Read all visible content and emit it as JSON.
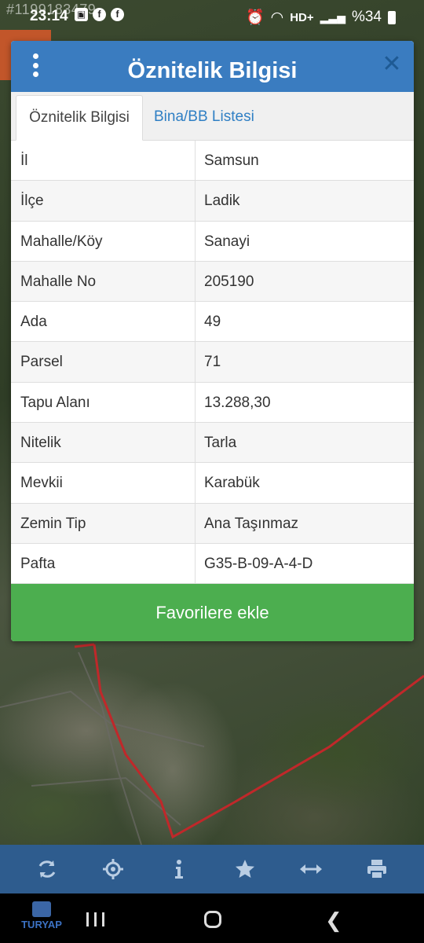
{
  "watermark": "#1199183479",
  "status_bar": {
    "time": "23:14",
    "network": "HD+",
    "battery": "%34"
  },
  "dialog": {
    "title": "Öznitelik Bilgisi",
    "tabs": [
      {
        "label": "Öznitelik Bilgisi",
        "active": true
      },
      {
        "label": "Bina/BB Listesi",
        "active": false
      }
    ],
    "attributes": [
      {
        "key": "İl",
        "value": "Samsun"
      },
      {
        "key": "İlçe",
        "value": "Ladik"
      },
      {
        "key": "Mahalle/Köy",
        "value": "Sanayi"
      },
      {
        "key": "Mahalle No",
        "value": "205190"
      },
      {
        "key": "Ada",
        "value": "49"
      },
      {
        "key": "Parsel",
        "value": "71"
      },
      {
        "key": "Tapu Alanı",
        "value": "13.288,30"
      },
      {
        "key": "Nitelik",
        "value": "Tarla"
      },
      {
        "key": "Mevkii",
        "value": "Karabük"
      },
      {
        "key": "Zemin Tip",
        "value": "Ana Taşınmaz"
      },
      {
        "key": "Pafta",
        "value": "G35-B-09-A-4-D"
      }
    ],
    "favorite_button": "Favorilere ekle"
  },
  "toolbar": {
    "icons": [
      "refresh-icon",
      "locate-icon",
      "info-icon",
      "star-icon",
      "measure-icon",
      "print-icon"
    ]
  },
  "navbar": {
    "logo_text": "TURYAP"
  },
  "colors": {
    "header_blue": "#3a7cc0",
    "tab_blue": "#2f7fc4",
    "favorite_green": "#4cae4f",
    "toolbar_blue": "#2e5c8e",
    "parcel_border": "#c0282a"
  }
}
